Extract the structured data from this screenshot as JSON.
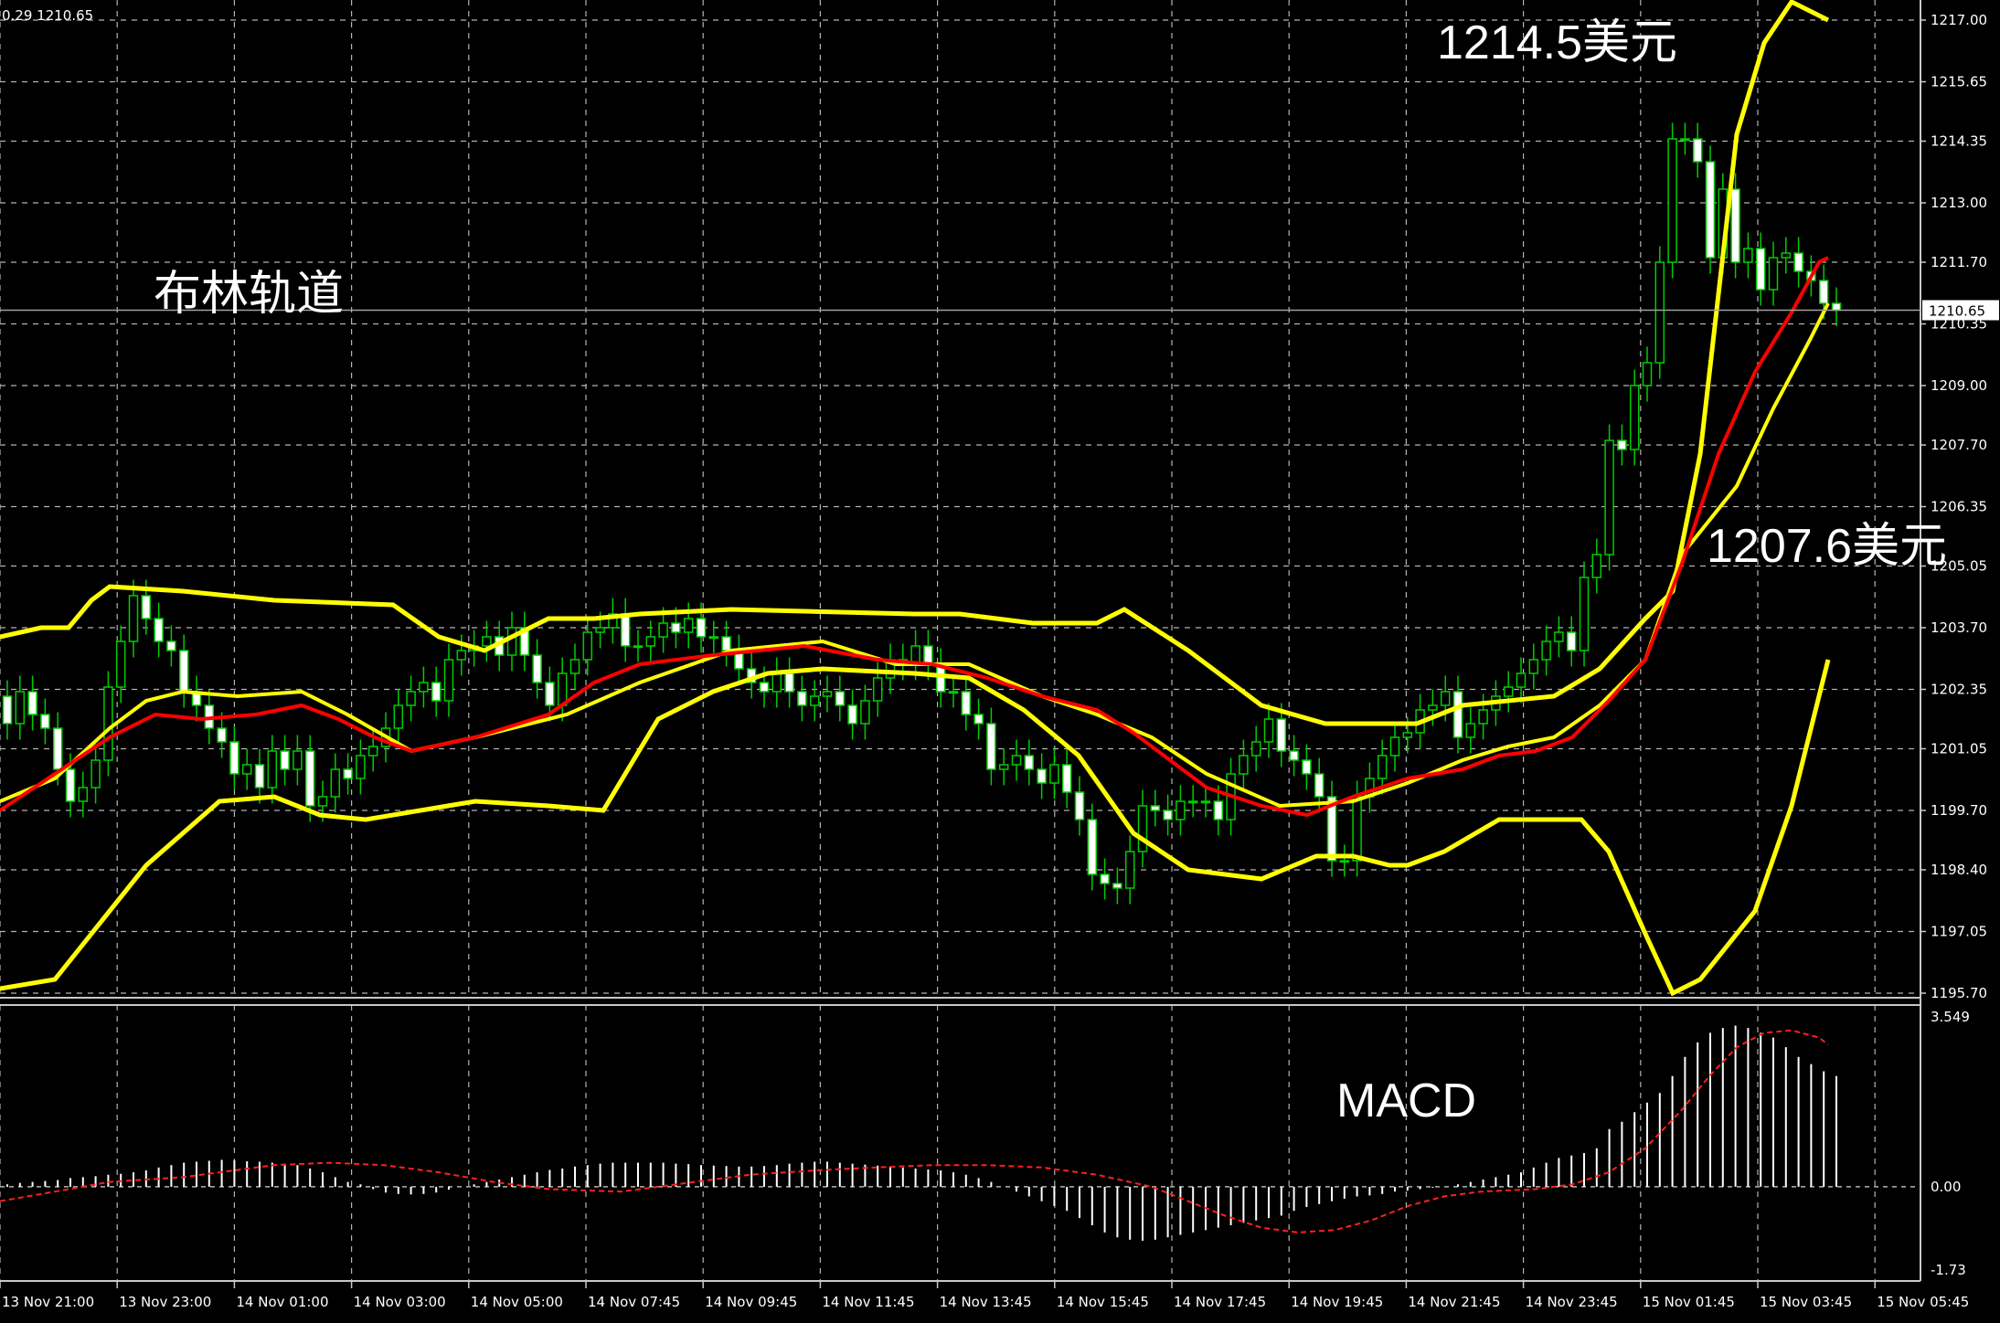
{
  "info_line": "0.29 1210.65",
  "current_price": "1210.65",
  "annotations": {
    "bollinger": "布林轨道",
    "upper_target": "1214.5美元",
    "lower_target": "1207.6美元",
    "macd": "MACD"
  },
  "colors": {
    "background": "#000000",
    "grid": "#b4b4b4",
    "axis": "#c8c8c8",
    "bull_candle": "#00cc00",
    "bear_candle": "#ffffff",
    "bollinger_outer": "#ffff00",
    "middle_line": "#ff0000",
    "macd_hist": "#ffffff",
    "macd_signal": "#ff0000"
  },
  "chart_data": [
    {
      "type": "candlestick",
      "title": "",
      "y_ticks": [
        "1217.00",
        "1215.65",
        "1214.35",
        "1213.00",
        "1211.70",
        "1210.35",
        "1209.00",
        "1207.70",
        "1206.35",
        "1205.05",
        "1203.70",
        "1202.35",
        "1201.05",
        "1199.70",
        "1198.40",
        "1197.05",
        "1195.70"
      ],
      "ylim": [
        1195.7,
        1217.0
      ],
      "x_ticks": [
        "13 Nov 21:00",
        "13 Nov 23:00",
        "14 Nov 01:00",
        "14 Nov 03:00",
        "14 Nov 05:00",
        "14 Nov 07:45",
        "14 Nov 09:45",
        "14 Nov 11:45",
        "14 Nov 13:45",
        "14 Nov 15:45",
        "14 Nov 17:45",
        "14 Nov 19:45",
        "14 Nov 21:45",
        "14 Nov 23:45",
        "15 Nov 01:45",
        "15 Nov 03:45",
        "15 Nov 05:45"
      ],
      "indicators": [
        "Bollinger Bands (yellow)",
        "Moving average (red)"
      ],
      "candles": {
        "open": [
          1202.2,
          1201.6,
          1202.3,
          1201.8,
          1201.5,
          1200.6,
          1199.9,
          1200.2,
          1200.8,
          1202.4,
          1203.4,
          1204.4,
          1203.9,
          1203.4,
          1203.2,
          1202.3,
          1202.0,
          1201.5,
          1201.2,
          1200.5,
          1200.7,
          1200.2,
          1201.0,
          1200.6,
          1201.0,
          1199.8,
          1200.0,
          1200.6,
          1200.4,
          1200.9,
          1201.1,
          1201.5,
          1202.0,
          1202.3,
          1202.5,
          1202.1,
          1203.0,
          1203.2,
          1203.3,
          1203.5,
          1203.1,
          1203.7,
          1203.1,
          1202.5,
          1202.0,
          1202.7,
          1203.0,
          1203.6,
          1203.7,
          1204.0,
          1203.3,
          1203.3,
          1203.5,
          1203.8,
          1203.6,
          1203.9,
          1203.5,
          1203.5,
          1203.2,
          1202.8,
          1202.5,
          1202.3,
          1202.7,
          1202.3,
          1202.0,
          1202.2,
          1202.3,
          1202.0,
          1201.6,
          1202.1,
          1202.6,
          1203.0,
          1202.9,
          1203.3,
          1202.9,
          1202.3,
          1202.3,
          1201.8,
          1201.6,
          1200.6,
          1200.7,
          1200.9,
          1200.6,
          1200.3,
          1200.7,
          1200.1,
          1199.5,
          1198.3,
          1198.1,
          1198.0,
          1198.8,
          1199.8,
          1199.7,
          1199.5,
          1199.9,
          1199.9,
          1199.9,
          1199.5,
          1200.5,
          1200.9,
          1201.2,
          1201.7,
          1201.0,
          1200.8,
          1200.5,
          1200.0,
          1198.6,
          1198.6,
          1200.0,
          1200.4,
          1200.9,
          1201.3,
          1201.4,
          1201.9,
          1202.0,
          1202.3,
          1201.3,
          1201.6,
          1201.9,
          1202.2,
          1202.4,
          1202.7,
          1203.0,
          1203.4,
          1203.6,
          1203.2,
          1204.8,
          1205.3,
          1207.8,
          1207.6,
          1209.0,
          1209.5,
          1211.7,
          1214.4,
          1214.4,
          1213.9,
          1211.8,
          1213.3,
          1211.7,
          1212.0,
          1211.1,
          1211.8,
          1211.9,
          1211.5,
          1211.3,
          1210.8
        ],
        "close": [
          1201.6,
          1202.3,
          1201.8,
          1201.5,
          1200.6,
          1199.9,
          1200.2,
          1200.8,
          1202.4,
          1203.4,
          1204.4,
          1203.9,
          1203.4,
          1203.2,
          1202.3,
          1202.0,
          1201.5,
          1201.2,
          1200.5,
          1200.7,
          1200.2,
          1201.0,
          1200.6,
          1201.0,
          1199.8,
          1200.0,
          1200.6,
          1200.4,
          1200.9,
          1201.1,
          1201.5,
          1202.0,
          1202.3,
          1202.5,
          1202.1,
          1203.0,
          1203.2,
          1203.3,
          1203.5,
          1203.1,
          1203.7,
          1203.1,
          1202.5,
          1202.0,
          1202.7,
          1203.0,
          1203.6,
          1203.7,
          1204.0,
          1203.3,
          1203.3,
          1203.5,
          1203.8,
          1203.6,
          1203.9,
          1203.5,
          1203.5,
          1203.2,
          1202.8,
          1202.5,
          1202.3,
          1202.7,
          1202.3,
          1202.0,
          1202.2,
          1202.3,
          1202.0,
          1201.6,
          1202.1,
          1202.6,
          1203.0,
          1202.9,
          1203.3,
          1202.9,
          1202.3,
          1202.3,
          1201.8,
          1201.6,
          1200.6,
          1200.7,
          1200.9,
          1200.6,
          1200.3,
          1200.7,
          1200.1,
          1199.5,
          1198.3,
          1198.1,
          1198.0,
          1198.8,
          1199.8,
          1199.7,
          1199.5,
          1199.9,
          1199.9,
          1199.9,
          1199.5,
          1200.5,
          1200.9,
          1201.2,
          1201.7,
          1201.0,
          1200.8,
          1200.5,
          1200.0,
          1198.6,
          1198.6,
          1200.0,
          1200.4,
          1200.9,
          1201.3,
          1201.4,
          1201.9,
          1202.0,
          1202.3,
          1201.3,
          1201.6,
          1201.9,
          1202.2,
          1202.4,
          1202.7,
          1203.0,
          1203.4,
          1203.6,
          1203.2,
          1204.8,
          1205.3,
          1207.8,
          1207.6,
          1209.0,
          1209.5,
          1211.7,
          1214.4,
          1214.4,
          1213.9,
          1211.8,
          1213.3,
          1211.7,
          1212.0,
          1211.1,
          1211.8,
          1211.9,
          1211.5,
          1211.3,
          1210.8,
          1210.65
        ]
      },
      "bollinger_upper": [
        [
          0,
          1203.5
        ],
        [
          45,
          1203.7
        ],
        [
          75,
          1203.7
        ],
        [
          100,
          1204.3
        ],
        [
          120,
          1204.6
        ],
        [
          200,
          1204.5
        ],
        [
          300,
          1204.3
        ],
        [
          430,
          1204.2
        ],
        [
          480,
          1203.5
        ],
        [
          530,
          1203.2
        ],
        [
          600,
          1203.9
        ],
        [
          650,
          1203.9
        ],
        [
          700,
          1204.0
        ],
        [
          800,
          1204.1
        ],
        [
          1000,
          1204.0
        ],
        [
          1050,
          1204.0
        ],
        [
          1130,
          1203.8
        ],
        [
          1200,
          1203.8
        ],
        [
          1230,
          1204.1
        ],
        [
          1300,
          1203.2
        ],
        [
          1380,
          1202.0
        ],
        [
          1450,
          1201.6
        ],
        [
          1500,
          1201.6
        ],
        [
          1550,
          1201.6
        ],
        [
          1600,
          1202.0
        ],
        [
          1700,
          1202.2
        ],
        [
          1750,
          1202.8
        ],
        [
          1800,
          1203.9
        ],
        [
          1830,
          1204.5
        ],
        [
          1860,
          1207.5
        ],
        [
          1880,
          1211.0
        ],
        [
          1900,
          1214.5
        ],
        [
          1930,
          1216.5
        ],
        [
          1960,
          1217.4
        ],
        [
          2000,
          1217.0
        ]
      ],
      "bollinger_middle": [
        [
          0,
          1199.9
        ],
        [
          60,
          1200.4
        ],
        [
          120,
          1201.5
        ],
        [
          160,
          1202.1
        ],
        [
          200,
          1202.3
        ],
        [
          260,
          1202.2
        ],
        [
          330,
          1202.3
        ],
        [
          380,
          1201.8
        ],
        [
          450,
          1201.0
        ],
        [
          520,
          1201.3
        ],
        [
          620,
          1201.8
        ],
        [
          700,
          1202.5
        ],
        [
          800,
          1203.2
        ],
        [
          900,
          1203.4
        ],
        [
          980,
          1202.9
        ],
        [
          1060,
          1202.9
        ],
        [
          1140,
          1202.2
        ],
        [
          1200,
          1201.8
        ],
        [
          1260,
          1201.3
        ],
        [
          1320,
          1200.5
        ],
        [
          1400,
          1199.8
        ],
        [
          1480,
          1199.9
        ],
        [
          1540,
          1200.3
        ],
        [
          1600,
          1200.8
        ],
        [
          1650,
          1201.1
        ],
        [
          1700,
          1201.3
        ],
        [
          1750,
          1202.0
        ],
        [
          1800,
          1203.0
        ],
        [
          1840,
          1205.3
        ],
        [
          1900,
          1206.8
        ],
        [
          1940,
          1208.5
        ],
        [
          1980,
          1210.0
        ],
        [
          2000,
          1210.8
        ]
      ],
      "bollinger_lower": [
        [
          0,
          1195.8
        ],
        [
          60,
          1196.0
        ],
        [
          100,
          1197.0
        ],
        [
          160,
          1198.5
        ],
        [
          240,
          1199.9
        ],
        [
          300,
          1200.0
        ],
        [
          350,
          1199.6
        ],
        [
          400,
          1199.5
        ],
        [
          460,
          1199.7
        ],
        [
          520,
          1199.9
        ],
        [
          600,
          1199.8
        ],
        [
          660,
          1199.7
        ],
        [
          720,
          1201.7
        ],
        [
          780,
          1202.3
        ],
        [
          840,
          1202.7
        ],
        [
          900,
          1202.8
        ],
        [
          1000,
          1202.7
        ],
        [
          1060,
          1202.6
        ],
        [
          1120,
          1201.9
        ],
        [
          1180,
          1200.9
        ],
        [
          1240,
          1199.2
        ],
        [
          1300,
          1198.4
        ],
        [
          1380,
          1198.2
        ],
        [
          1440,
          1198.7
        ],
        [
          1480,
          1198.7
        ],
        [
          1520,
          1198.5
        ],
        [
          1540,
          1198.5
        ],
        [
          1580,
          1198.8
        ],
        [
          1640,
          1199.5
        ],
        [
          1700,
          1199.5
        ],
        [
          1730,
          1199.5
        ],
        [
          1760,
          1198.8
        ],
        [
          1800,
          1197.0
        ],
        [
          1830,
          1195.7
        ],
        [
          1860,
          1196.0
        ],
        [
          1920,
          1197.5
        ],
        [
          1960,
          1199.8
        ],
        [
          2000,
          1203.0
        ]
      ],
      "middle_ma": [
        [
          0,
          1199.7
        ],
        [
          60,
          1200.5
        ],
        [
          120,
          1201.3
        ],
        [
          170,
          1201.8
        ],
        [
          220,
          1201.7
        ],
        [
          280,
          1201.8
        ],
        [
          330,
          1202.0
        ],
        [
          370,
          1201.7
        ],
        [
          410,
          1201.3
        ],
        [
          450,
          1201.0
        ],
        [
          520,
          1201.3
        ],
        [
          600,
          1201.8
        ],
        [
          650,
          1202.5
        ],
        [
          700,
          1202.9
        ],
        [
          780,
          1203.1
        ],
        [
          880,
          1203.3
        ],
        [
          960,
          1203.0
        ],
        [
          1020,
          1202.9
        ],
        [
          1080,
          1202.6
        ],
        [
          1140,
          1202.2
        ],
        [
          1200,
          1201.9
        ],
        [
          1240,
          1201.4
        ],
        [
          1280,
          1200.8
        ],
        [
          1320,
          1200.2
        ],
        [
          1380,
          1199.8
        ],
        [
          1430,
          1199.6
        ],
        [
          1480,
          1200.0
        ],
        [
          1540,
          1200.4
        ],
        [
          1600,
          1200.6
        ],
        [
          1640,
          1200.9
        ],
        [
          1680,
          1201.0
        ],
        [
          1720,
          1201.3
        ],
        [
          1760,
          1202.1
        ],
        [
          1800,
          1203.0
        ],
        [
          1840,
          1205.1
        ],
        [
          1880,
          1207.5
        ],
        [
          1920,
          1209.3
        ],
        [
          1960,
          1210.6
        ],
        [
          1990,
          1211.7
        ],
        [
          2000,
          1211.8
        ]
      ],
      "current_price_line": 1210.65
    },
    {
      "type": "bar",
      "title": "",
      "y_ticks": [
        "3.549",
        "0.00",
        "-1.73"
      ],
      "ylim": [
        -1.73,
        3.549
      ],
      "histogram": [
        0.05,
        0.08,
        0.1,
        0.12,
        0.14,
        0.18,
        0.2,
        0.22,
        0.25,
        0.27,
        0.3,
        0.34,
        0.4,
        0.45,
        0.5,
        0.52,
        0.54,
        0.56,
        0.55,
        0.53,
        0.52,
        0.5,
        0.48,
        0.45,
        0.38,
        0.3,
        0.2,
        0.1,
        0.05,
        -0.05,
        -0.12,
        -0.15,
        -0.16,
        -0.15,
        -0.12,
        -0.06,
        0.0,
        0.05,
        0.1,
        0.15,
        0.2,
        0.25,
        0.3,
        0.35,
        0.38,
        0.42,
        0.45,
        0.48,
        0.5,
        0.5,
        0.5,
        0.5,
        0.5,
        0.48,
        0.47,
        0.45,
        0.44,
        0.43,
        0.42,
        0.42,
        0.43,
        0.45,
        0.48,
        0.5,
        0.52,
        0.52,
        0.5,
        0.48,
        0.46,
        0.44,
        0.42,
        0.4,
        0.38,
        0.36,
        0.34,
        0.3,
        0.25,
        0.18,
        0.1,
        0.0,
        -0.1,
        -0.2,
        -0.3,
        -0.4,
        -0.5,
        -0.65,
        -0.8,
        -0.95,
        -1.05,
        -1.1,
        -1.12,
        -1.1,
        -1.05,
        -1.0,
        -0.95,
        -0.9,
        -0.85,
        -0.8,
        -0.75,
        -0.7,
        -0.65,
        -0.6,
        -0.5,
        -0.42,
        -0.36,
        -0.3,
        -0.25,
        -0.2,
        -0.18,
        -0.15,
        -0.1,
        -0.08,
        -0.05,
        -0.02,
        0.0,
        0.05,
        0.1,
        0.15,
        0.2,
        0.25,
        0.3,
        0.4,
        0.5,
        0.6,
        0.65,
        0.7,
        0.8,
        1.2,
        1.35,
        1.55,
        1.75,
        1.95,
        2.3,
        2.7,
        3.0,
        3.2,
        3.3,
        3.35,
        3.3,
        3.2,
        3.1,
        2.9,
        2.7,
        2.55,
        2.4,
        2.3
      ],
      "signal": [
        [
          0,
          -0.3
        ],
        [
          60,
          -0.1
        ],
        [
          120,
          0.1
        ],
        [
          200,
          0.2
        ],
        [
          260,
          0.35
        ],
        [
          300,
          0.45
        ],
        [
          360,
          0.5
        ],
        [
          420,
          0.45
        ],
        [
          480,
          0.3
        ],
        [
          540,
          0.1
        ],
        [
          600,
          -0.05
        ],
        [
          680,
          -0.1
        ],
        [
          760,
          0.1
        ],
        [
          820,
          0.25
        ],
        [
          900,
          0.35
        ],
        [
          980,
          0.42
        ],
        [
          1020,
          0.45
        ],
        [
          1080,
          0.45
        ],
        [
          1140,
          0.4
        ],
        [
          1200,
          0.25
        ],
        [
          1260,
          0.0
        ],
        [
          1300,
          -0.3
        ],
        [
          1340,
          -0.6
        ],
        [
          1380,
          -0.85
        ],
        [
          1420,
          -0.95
        ],
        [
          1460,
          -0.9
        ],
        [
          1500,
          -0.7
        ],
        [
          1540,
          -0.4
        ],
        [
          1580,
          -0.2
        ],
        [
          1620,
          -0.1
        ],
        [
          1680,
          -0.05
        ],
        [
          1720,
          0.05
        ],
        [
          1760,
          0.3
        ],
        [
          1800,
          0.8
        ],
        [
          1840,
          1.6
        ],
        [
          1870,
          2.3
        ],
        [
          1900,
          2.9
        ],
        [
          1930,
          3.2
        ],
        [
          1960,
          3.25
        ],
        [
          1990,
          3.1
        ],
        [
          2000,
          2.95
        ]
      ]
    }
  ]
}
